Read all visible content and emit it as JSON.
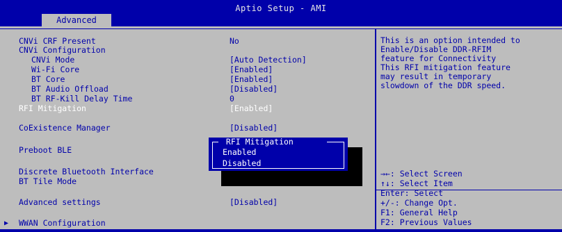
{
  "app_title": "Aptio Setup - AMI",
  "tabs": [
    {
      "label": "Advanced"
    }
  ],
  "settings": [
    {
      "label": "CNVi CRF Present",
      "value": "No"
    },
    {
      "label": "CNVi Configuration",
      "value": ""
    },
    {
      "label": "CNVi Mode",
      "value": "[Auto Detection]"
    },
    {
      "label": "Wi-Fi Core",
      "value": "[Enabled]"
    },
    {
      "label": "BT Core",
      "value": "[Enabled]"
    },
    {
      "label": "BT Audio Offload",
      "value": "[Disabled]"
    },
    {
      "label": "BT RF-Kill Delay Time",
      "value": "0"
    },
    {
      "label": "RFI Mitigation",
      "value": "[Enabled]"
    },
    {
      "label": "CoExistence Manager",
      "value": "[Disabled]"
    },
    {
      "label": "Preboot BLE",
      "value": ""
    },
    {
      "label": "Discrete Bluetooth Interface",
      "value": ""
    },
    {
      "label": "BT Tile Mode",
      "value": ""
    },
    {
      "label": "Advanced settings",
      "value": "[Disabled]"
    },
    {
      "label": "WWAN Configuration",
      "value": ""
    }
  ],
  "submenu_arrow": "▶",
  "help": {
    "lines": [
      "This is an option intended to",
      "Enable/Disable DDR-RFIM",
      "feature for Connectivity",
      "This RFI mitigation feature",
      "may result in temporary",
      "slowdown of the DDR speed."
    ]
  },
  "keys": [
    "→←: Select Screen",
    "↑↓: Select Item",
    "Enter: Select",
    "+/-: Change Opt.",
    "F1: General Help",
    "F2: Previous Values"
  ],
  "popup": {
    "title": " RFI Mitigation ",
    "options": [
      "Enabled",
      "Disabled"
    ]
  },
  "colors": {
    "background": "#0000aa",
    "panel": "#bdbdbd",
    "text": "#0000aa",
    "highlight": "#ffffff"
  }
}
